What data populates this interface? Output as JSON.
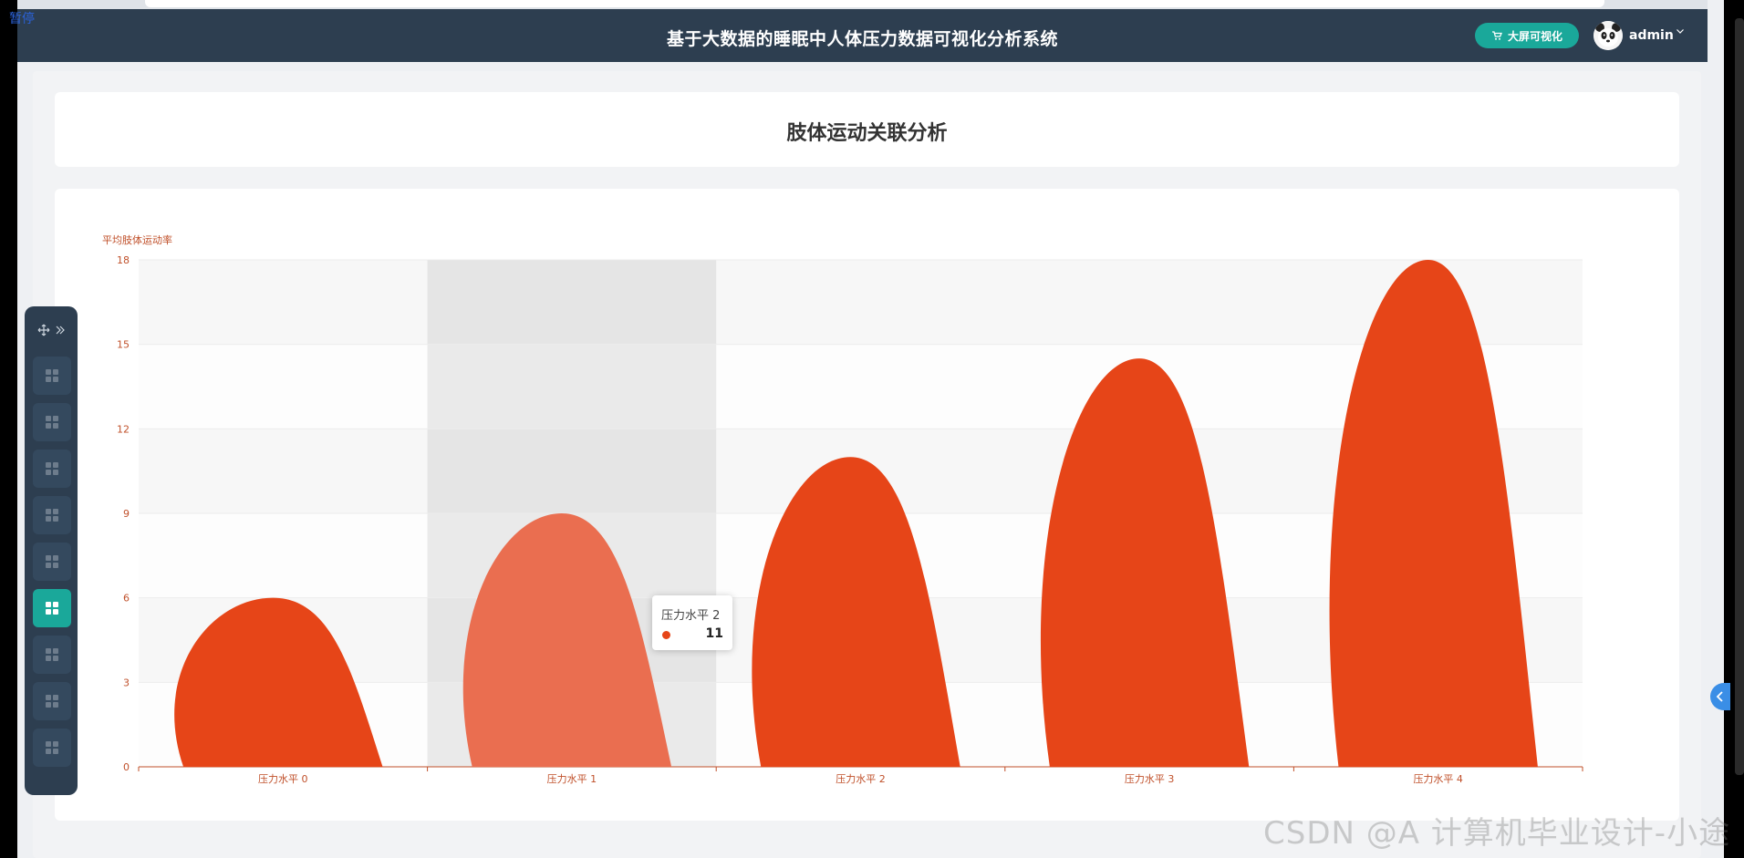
{
  "app": {
    "title": "基于大数据的睡眠中人体压力数据可视化分析系统",
    "pause_label": "暂停",
    "big_screen_button": "大屏可视化",
    "user_name": "admin"
  },
  "page": {
    "title": "肢体运动关联分析"
  },
  "side_nav": {
    "item_count": 9,
    "active_index": 5
  },
  "tooltip": {
    "title": "压力水平 2",
    "value": "11"
  },
  "watermark": "CSDN @A 计算机毕业设计-小途",
  "colors": {
    "header": "#2d3e50",
    "accent": "#1aa89a",
    "bar": "#e64518",
    "bar_highlight": "#ea6e50",
    "axis": "#c0502a"
  },
  "chart_data": {
    "type": "bar",
    "ylabel": "平均肢体运动率",
    "categories": [
      "压力水平 0",
      "压力水平 1",
      "压力水平 2",
      "压力水平 3",
      "压力水平 4"
    ],
    "values": [
      6,
      9,
      11,
      14.5,
      18
    ],
    "ylim": [
      0,
      18
    ],
    "yticks": [
      0,
      3,
      6,
      9,
      12,
      15,
      18
    ],
    "highlighted_category": "压力水平 1",
    "grid": true,
    "split_area": true
  }
}
